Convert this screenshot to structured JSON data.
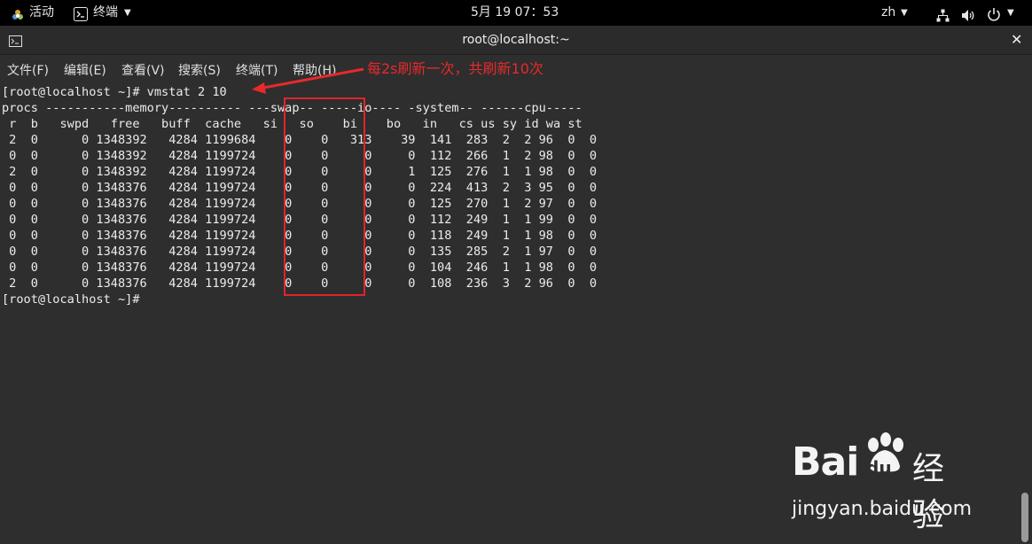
{
  "topbar": {
    "activities": "活动",
    "app_name": "终端",
    "clock": "5月 19  07：53",
    "lang": "zh"
  },
  "window": {
    "title": "root@localhost:~"
  },
  "menu": [
    "文件(F)",
    "编辑(E)",
    "查看(V)",
    "搜索(S)",
    "终端(T)",
    "帮助(H)"
  ],
  "terminal": {
    "lines": [
      "[root@localhost ~]# vmstat 2 10",
      "procs -----------memory---------- ---swap-- -----io---- -system-- ------cpu-----",
      " r  b   swpd   free   buff  cache   si   so    bi    bo   in   cs us sy id wa st",
      " 2  0      0 1348392   4284 1199684    0    0   313    39  141  283  2  2 96  0  0",
      " 0  0      0 1348392   4284 1199724    0    0     0     0  112  266  1  2 98  0  0",
      " 2  0      0 1348392   4284 1199724    0    0     0     1  125  276  1  1 98  0  0",
      " 0  0      0 1348376   4284 1199724    0    0     0     0  224  413  2  3 95  0  0",
      " 0  0      0 1348376   4284 1199724    0    0     0     0  125  270  1  2 97  0  0",
      " 0  0      0 1348376   4284 1199724    0    0     0     0  112  249  1  1 99  0  0",
      " 0  0      0 1348376   4284 1199724    0    0     0     0  118  249  1  1 98  0  0",
      " 0  0      0 1348376   4284 1199724    0    0     0     0  135  285  2  1 97  0  0",
      " 0  0      0 1348376   4284 1199724    0    0     0     0  104  246  1  1 98  0  0",
      " 2  0      0 1348376   4284 1199724    0    0     0     0  108  236  3  2 96  0  0",
      "[root@localhost ~]# "
    ]
  },
  "annotation": {
    "text": "每2s刷新一次，共刷新10次",
    "color": "#e8292b"
  },
  "watermark": {
    "brand": "Bai",
    "brand_du": "du",
    "cn": "经验",
    "url": "jingyan.baidu.com"
  }
}
